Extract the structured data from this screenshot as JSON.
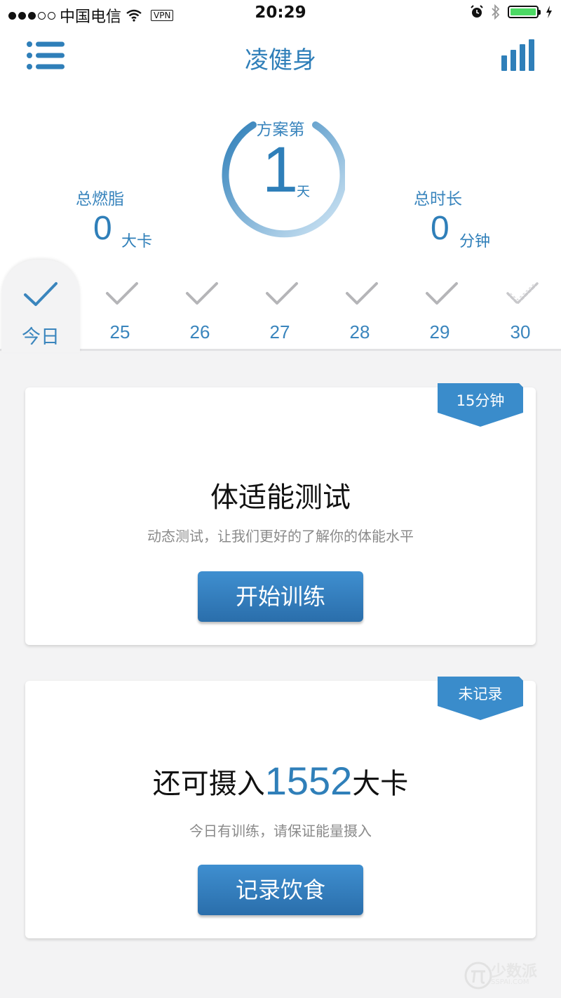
{
  "status_bar": {
    "carrier": "中国电信",
    "vpn": "VPN",
    "time": "20:29"
  },
  "nav": {
    "title": "凌健身"
  },
  "plan": {
    "label": "方案第",
    "day": "1",
    "unit": "天"
  },
  "stats": {
    "fat_label": "总燃脂",
    "fat_value": "0",
    "fat_unit": "大卡",
    "time_label": "总时长",
    "time_value": "0",
    "time_unit": "分钟"
  },
  "days": {
    "today": "今日",
    "items": [
      "25",
      "26",
      "27",
      "28",
      "29",
      "30"
    ]
  },
  "card_test": {
    "badge": "15分钟",
    "title": "体适能测试",
    "subtitle": "动态测试，让我们更好的了解你的体能水平",
    "button": "开始训练"
  },
  "card_diet": {
    "badge": "未记录",
    "title_prefix": "还可摄入",
    "kcal": "1552",
    "title_suffix": "大卡",
    "subtitle": "今日有训练，请保证能量摄入",
    "button": "记录饮食"
  },
  "watermark": {
    "text": "少数派",
    "sub": "SSPAI.COM"
  },
  "colors": {
    "accent": "#2f7fb9",
    "button": "#3583c3",
    "background": "#f3f3f4"
  }
}
